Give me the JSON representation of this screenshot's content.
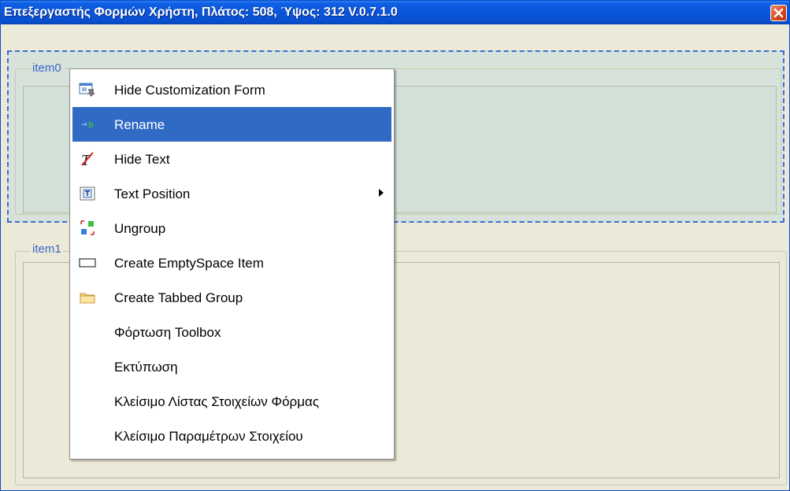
{
  "window": {
    "title": "Επεξεργαστής Φορμών Χρήστη, Πλάτος: 508, Ύψος: 312 V.0.7.1.0"
  },
  "layout": {
    "groups": [
      {
        "label": "item0"
      },
      {
        "label": "item1"
      }
    ]
  },
  "context_menu": {
    "items": [
      {
        "label": "Hide Customization Form",
        "icon": "customization-form-icon"
      },
      {
        "label": "Rename",
        "icon": "rename-icon",
        "selected": true
      },
      {
        "label": "Hide Text",
        "icon": "hide-text-icon"
      },
      {
        "label": "Text Position",
        "icon": "text-position-icon",
        "submenu": true
      },
      {
        "label": "Ungroup",
        "icon": "ungroup-icon"
      },
      {
        "label": "Create EmptySpace Item",
        "icon": "empty-space-icon"
      },
      {
        "label": "Create Tabbed Group",
        "icon": "folder-icon"
      },
      {
        "label": "Φόρτωση Toolbox"
      },
      {
        "label": "Εκτύπωση"
      },
      {
        "label": "Κλείσιμο Λίστας Στοιχείων Φόρμας"
      },
      {
        "label": "Κλείσιμο Παραμέτρων Στοιχείου"
      }
    ]
  },
  "colors": {
    "titlebar": "#0b55da",
    "selection": "#316ac5",
    "group_label": "#3b66c8"
  }
}
